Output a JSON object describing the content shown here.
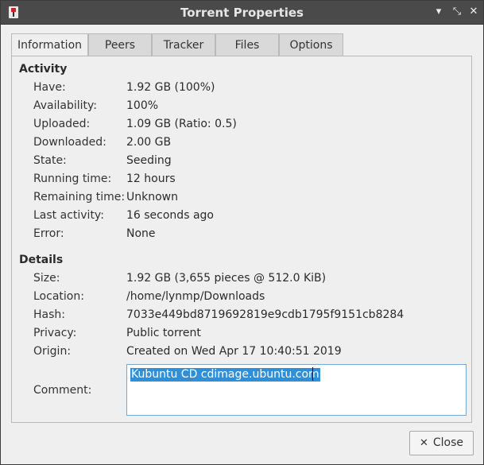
{
  "window": {
    "title": "Torrent Properties"
  },
  "titlebar": {
    "minimize": "▾",
    "maximize": "⤡",
    "close": "✕"
  },
  "tabs": [
    {
      "label": "Information",
      "active": true
    },
    {
      "label": "Peers"
    },
    {
      "label": "Tracker"
    },
    {
      "label": "Files"
    },
    {
      "label": "Options"
    }
  ],
  "activity": {
    "title": "Activity",
    "rows": [
      {
        "label": "Have:",
        "value": "1.92 GB (100%)"
      },
      {
        "label": "Availability:",
        "value": "100%"
      },
      {
        "label": "Uploaded:",
        "value": "1.09 GB (Ratio: 0.5)"
      },
      {
        "label": "Downloaded:",
        "value": "2.00 GB"
      },
      {
        "label": "State:",
        "value": "Seeding"
      },
      {
        "label": "Running time:",
        "value": "12 hours"
      },
      {
        "label": "Remaining time:",
        "value": "Unknown"
      },
      {
        "label": "Last activity:",
        "value": "16 seconds ago"
      },
      {
        "label": "Error:",
        "value": "None"
      }
    ]
  },
  "details": {
    "title": "Details",
    "rows": [
      {
        "label": "Size:",
        "value": "1.92 GB (3,655 pieces @ 512.0 KiB)"
      },
      {
        "label": "Location:",
        "value": "/home/lynmp/Downloads"
      },
      {
        "label": "Hash:",
        "value": "7033e449bd8719692819e9cdb1795f9151cb8284"
      },
      {
        "label": "Privacy:",
        "value": "Public torrent"
      },
      {
        "label": "Origin:",
        "value": "Created on Wed Apr 17 10:40:51 2019"
      }
    ],
    "comment_label": "Comment:",
    "comment_value": "Kubuntu CD cdimage.ubuntu.com"
  },
  "footer": {
    "close_label": "Close",
    "close_icon": "✕"
  }
}
